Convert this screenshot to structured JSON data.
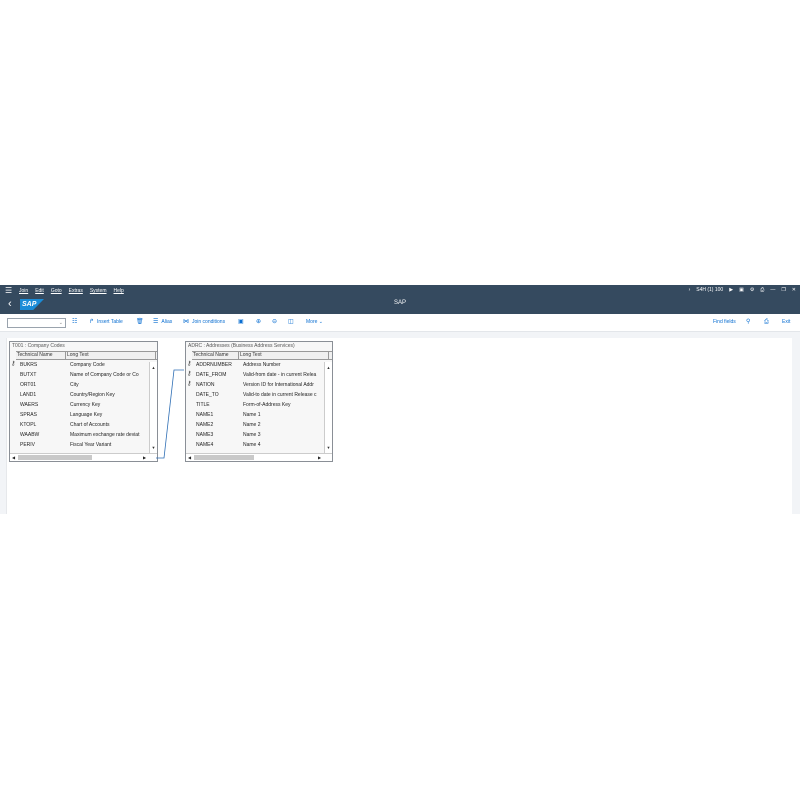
{
  "menubar": {
    "menus": [
      "Join",
      "Edit",
      "Goto",
      "Extras",
      "System",
      "Help"
    ],
    "system_info": "S4H (1) 100"
  },
  "shell": {
    "logo": "SAP",
    "title": "SAP"
  },
  "toolbar": {
    "insert_table": "Insert Table",
    "alias": "Alias",
    "join_conditions": "Join conditions",
    "more": "More",
    "find_fields": "Find fields",
    "exit": "Exit"
  },
  "tables": [
    {
      "header": "T001 : Company Codes",
      "col_tech": "Technical Name",
      "col_long": "Long Text",
      "rows": [
        {
          "key": true,
          "tech": "BUKRS",
          "long": "Company Code"
        },
        {
          "key": false,
          "tech": "BUTXT",
          "long": "Name of Company Code or Co"
        },
        {
          "key": false,
          "tech": "ORT01",
          "long": "City"
        },
        {
          "key": false,
          "tech": "LAND1",
          "long": "Country/Region Key"
        },
        {
          "key": false,
          "tech": "WAERS",
          "long": "Currency Key"
        },
        {
          "key": false,
          "tech": "SPRAS",
          "long": "Language Key"
        },
        {
          "key": false,
          "tech": "KTOPL",
          "long": "Chart of Accounts"
        },
        {
          "key": false,
          "tech": "WAABW",
          "long": "Maximum exchange rate deviat"
        },
        {
          "key": false,
          "tech": "PERIV",
          "long": "Fiscal Year Variant"
        }
      ]
    },
    {
      "header": "ADRC : Addresses (Business Address Services)",
      "col_tech": "Technical Name",
      "col_long": "Long Text",
      "rows": [
        {
          "key": true,
          "tech": "ADDRNUMBER",
          "long": "Address Number"
        },
        {
          "key": true,
          "tech": "DATE_FROM",
          "long": "Valid-from date - in current Relea"
        },
        {
          "key": true,
          "tech": "NATION",
          "long": "Version ID for International Addr"
        },
        {
          "key": false,
          "tech": "DATE_TO",
          "long": "Valid-to date in current Release c"
        },
        {
          "key": false,
          "tech": "TITLE",
          "long": "Form-of-Address Key"
        },
        {
          "key": false,
          "tech": "NAME1",
          "long": "Name 1"
        },
        {
          "key": false,
          "tech": "NAME2",
          "long": "Name 2"
        },
        {
          "key": false,
          "tech": "NAME3",
          "long": "Name 3"
        },
        {
          "key": false,
          "tech": "NAME4",
          "long": "Name 4"
        }
      ]
    }
  ]
}
